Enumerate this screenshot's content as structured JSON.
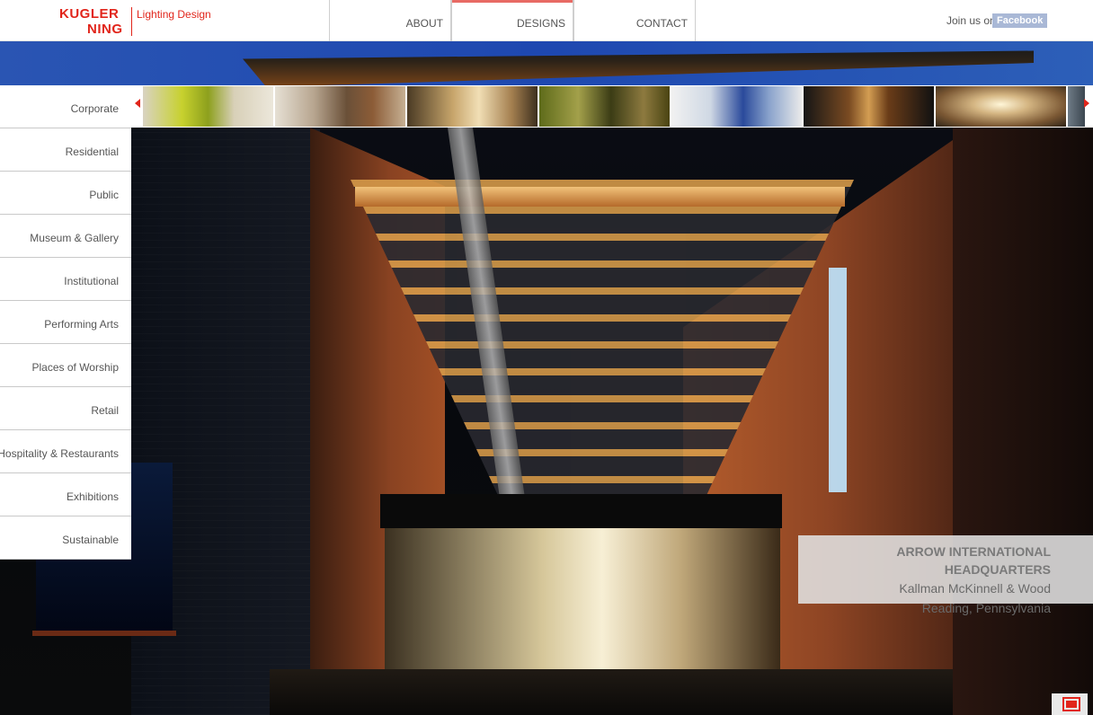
{
  "brand": {
    "line1": "KUGLER",
    "line2": "NING",
    "tagline": "Lighting Design",
    "color": "#e1251b"
  },
  "nav": {
    "items": [
      {
        "label": "ABOUT"
      },
      {
        "label": "DESIGNS"
      },
      {
        "label": "CONTACT"
      }
    ],
    "active": "DESIGNS"
  },
  "social": {
    "join_label": "Join us on",
    "facebook_label": "Facebook"
  },
  "categories": [
    {
      "label": "Corporate"
    },
    {
      "label": "Residential"
    },
    {
      "label": "Public"
    },
    {
      "label": "Museum & Gallery"
    },
    {
      "label": "Institutional"
    },
    {
      "label": "Performing Arts"
    },
    {
      "label": "Places of Worship"
    },
    {
      "label": "Retail"
    },
    {
      "label": "Hospitality & Restaurants"
    },
    {
      "label": "Exhibitions"
    },
    {
      "label": "Sustainable"
    }
  ],
  "thumbnails": {
    "prev_icon": "arrow-left-icon",
    "next_icon": "arrow-right-icon",
    "count_visible": 8
  },
  "project": {
    "title": "ARROW INTERNATIONAL HEADQUARTERS",
    "architect": "Kallman McKinnell & Wood",
    "location": "Reading, Pennsylvania"
  },
  "fullscreen": {
    "icon": "fullscreen-icon"
  }
}
